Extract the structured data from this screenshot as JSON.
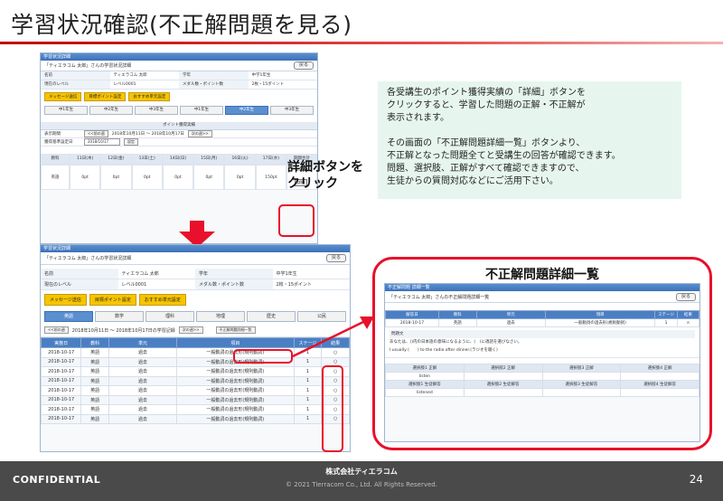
{
  "slide": {
    "title": "学習状況確認(不正解問題を見る)",
    "callout_lines": [
      "詳細ボタンを",
      "クリック"
    ],
    "note_lines": [
      "各受講生のポイント獲得実績の「詳細」ボタンを",
      "クリックすると、学習した問題の正解・不正解が",
      "表示されます。",
      "その画面の「不正解問題詳細一覧」ボタンより、",
      "不正解となった問題全てと受講生の回答が確認できます。",
      "問題、選択肢、正解がすべて確認できますので、",
      "生徒からの質問対応などにご活用下さい。"
    ]
  },
  "shot1": {
    "window_title": "学習状況詳細",
    "header": "「ティエラコム 太郎」さんの学習状況詳細",
    "back_label": "戻る",
    "info": [
      [
        "名前",
        "ティエラコム 太郎",
        "学年",
        "中学1年生"
      ],
      [
        "現在のレベル",
        "レベル0001",
        "メダル数・ポイント数",
        "2枚・15ポイント"
      ]
    ],
    "buttons": [
      "メッセージ送信",
      "目標ポイント設定",
      "おすすめ単元設定"
    ],
    "tabs": [
      "中1年生",
      "中2年生",
      "中3年生",
      "中1年生",
      "中2年生",
      "中3年生"
    ],
    "active_tab": 4,
    "panel_title": "ポイント獲得実績",
    "period_label": "表示期間",
    "prev_label": "<<前の週",
    "period_text": "2018年10月11日 ～ 2018年10月17日",
    "next_label": "次の週>>",
    "target_label": "獲得基準設定日",
    "target_value": "2018/10/17",
    "target_btn": "設定",
    "date_headers": [
      "教科",
      "11日(木)",
      "12日(金)",
      "13日(土)",
      "14日(日)",
      "15日(月)",
      "16日(火)",
      "17日(水)"
    ],
    "subject": "英語",
    "cells": [
      "0pt",
      "0pt",
      "0pt",
      "0pt",
      "0pt",
      "0pt",
      "150pt"
    ],
    "total_header": "期間合計",
    "total_value": "150pt",
    "detail_label": "詳細"
  },
  "shot2": {
    "window_title": "学習状況詳細",
    "header": "「ティエラコム 太郎」さんの学習状況詳細",
    "back_label": "戻る",
    "info": [
      [
        "名前",
        "ティエラコム 太郎",
        "学年",
        "中学1年生"
      ],
      [
        "現在のレベル",
        "レベル0001",
        "メダル数・ポイント数",
        "2枚・15ポイント"
      ]
    ],
    "buttons": [
      "メッセージ送信",
      "目標ポイント設定",
      "おすすめ単元設定"
    ],
    "tabs": [
      "英語",
      "数学",
      "理科",
      "地理",
      "歴史",
      "公民"
    ],
    "active_tab": 0,
    "prev_label": "<<前の週",
    "period_text": "2018年10月11日 ～ 2018年10月17日の学習記録",
    "next_label": "次の週>>",
    "wrong_list_label": "不正解問題詳細一覧",
    "columns": [
      "実施日",
      "教科",
      "単元",
      "項目",
      "ステージ",
      "結果"
    ],
    "rows": [
      [
        "2018-10-17",
        "英語",
        "過去",
        "一般動詞の過去形(規則動詞)",
        "1",
        "○"
      ],
      [
        "2018-10-17",
        "英語",
        "過去",
        "一般動詞の過去形(規則動詞)",
        "1",
        "○"
      ],
      [
        "2018-10-17",
        "英語",
        "過去",
        "一般動詞の過去形(規則動詞)",
        "1",
        "○"
      ],
      [
        "2018-10-17",
        "英語",
        "過去",
        "一般動詞の過去形(規則動詞)",
        "1",
        "○"
      ],
      [
        "2018-10-17",
        "英語",
        "過去",
        "一般動詞の過去形(規則動詞)",
        "1",
        "○"
      ],
      [
        "2018-10-17",
        "英語",
        "過去",
        "一般動詞の過去形(規則動詞)",
        "1",
        "○"
      ],
      [
        "2018-10-17",
        "英語",
        "過去",
        "一般動詞の過去形(規則動詞)",
        "1",
        "○"
      ],
      [
        "2018-10-17",
        "英語",
        "過去",
        "一般動詞の過去形(規則動詞)",
        "1",
        "○"
      ]
    ]
  },
  "popup": {
    "title": "不正解問題詳細一覧",
    "window_title": "不正解問題 詳細一覧",
    "header": "「ティエラコム 太郎」さんの不正解問題詳細一覧",
    "back_label": "戻る",
    "columns": [
      "解答日",
      "教科",
      "単元",
      "項目",
      "ステージ",
      "結果"
    ],
    "row": [
      "2018-10-17",
      "英語",
      "過去",
      "一般動詞の過去形(規則動詞)",
      "1",
      "×"
    ],
    "question_label": "問題文",
    "question_jp": "あなたは、()内の日本語の意味になるように、(　)に適語を選びなさい。",
    "question_en": "I usually (　　) to the radio after dinner.(ラジオを聴く)",
    "choice_headers": [
      "選択肢1 正解",
      "選択肢2 正解",
      "選択肢3 正解",
      "選択肢4 正解"
    ],
    "choice_values": [
      "listen",
      "",
      "",
      ""
    ],
    "answer_headers": [
      "選択肢1 生徒解答",
      "選択肢2 生徒解答",
      "選択肢3 生徒解答",
      "選択肢4 生徒解答"
    ],
    "answer_values": [
      "listened",
      "",
      "",
      ""
    ]
  },
  "footer": {
    "confidential": "CONFIDENTIAL",
    "company": "株式会社ティエラコム",
    "copyright": "© 2021 Tierracom Co., Ltd. All Rights Reserved.",
    "page": "24"
  }
}
